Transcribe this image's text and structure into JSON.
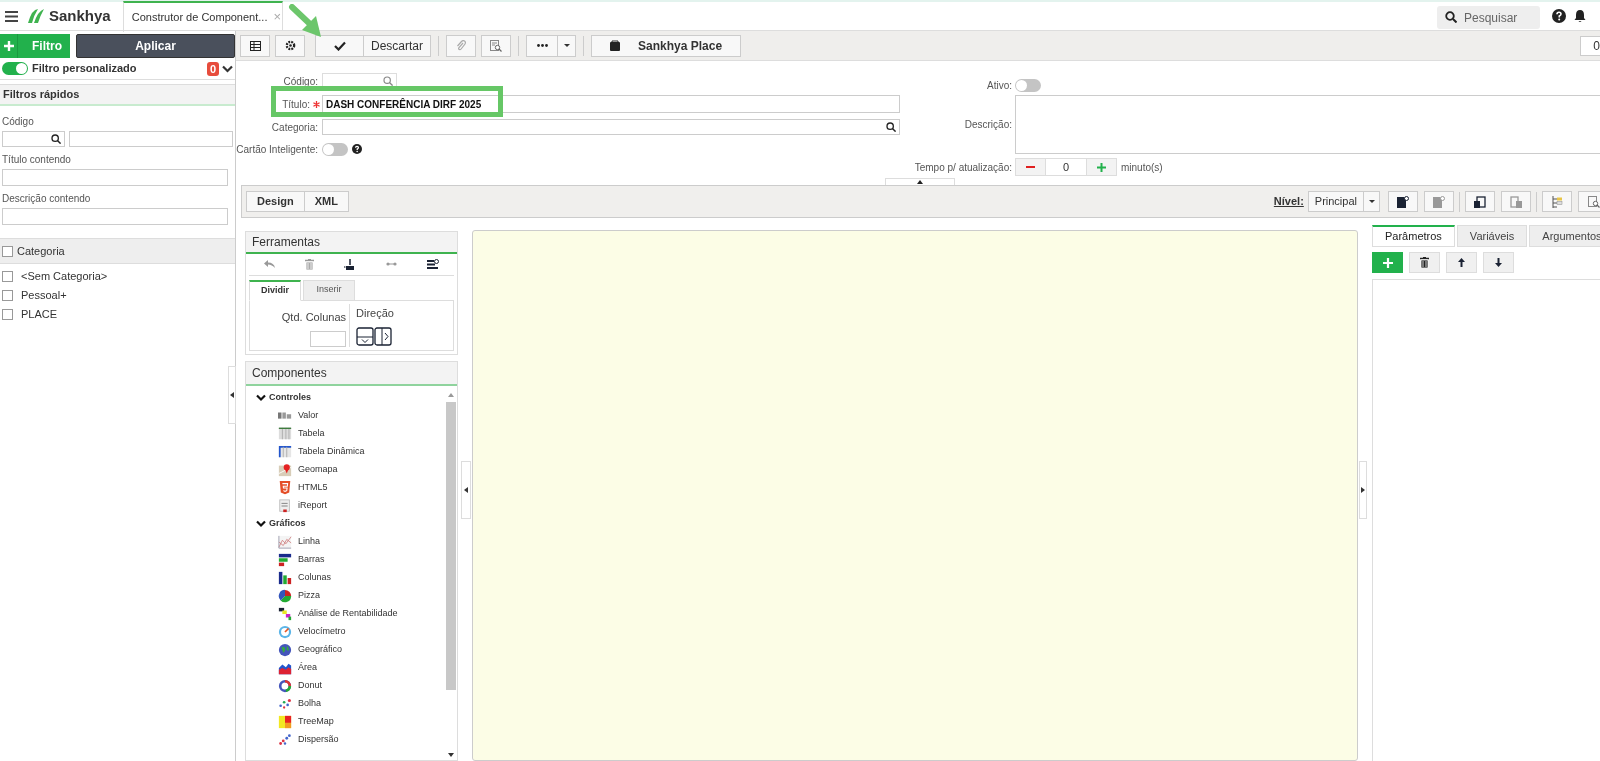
{
  "header": {
    "logo": "Sankhya",
    "tab": {
      "label": "Construtor de Component...",
      "close": "×"
    },
    "search": {
      "placeholder": "Pesquisar"
    }
  },
  "toolbar": {
    "discard": "Descartar",
    "place": "Sankhya Place",
    "page": "0"
  },
  "sidebar": {
    "filter_button": "Filtro",
    "apply_button": "Aplicar",
    "custom_filter": {
      "label": "Filtro personalizado",
      "on": true,
      "count": "0"
    },
    "quick_filters": {
      "title": "Filtros rápidos",
      "fields": [
        {
          "label": "Código",
          "kind": "lookup"
        },
        {
          "label": "Título contendo",
          "kind": "text"
        },
        {
          "label": "Descrição contendo",
          "kind": "text"
        }
      ]
    },
    "categories": {
      "header": "Categoria",
      "checked": false,
      "items": [
        {
          "label": "<Sem Categoria>",
          "checked": false
        },
        {
          "label": "Pessoal+",
          "checked": false
        },
        {
          "label": "PLACE",
          "checked": false
        }
      ]
    }
  },
  "form": {
    "code_label": "Código:",
    "title": {
      "label": "Título:",
      "required": true,
      "value": "DASH CONFERÊNCIA DIRF 2025"
    },
    "category_label": "Categoria:",
    "smart_card": {
      "label": "Cartão Inteligente:",
      "on": false
    },
    "active": {
      "label": "Ativo:",
      "on": false
    },
    "description_label": "Descrição:",
    "refresh": {
      "label": "Tempo p/ atualização:",
      "value": "0",
      "unit": "minuto(s)"
    }
  },
  "design_bar": {
    "views": [
      "Design",
      "XML"
    ],
    "level_label": "Nível:",
    "level_value": "Principal"
  },
  "tools": {
    "title": "Ferramentas",
    "tabs": [
      {
        "label": "Dividir",
        "selected": true
      },
      {
        "label": "Inserir",
        "selected": false
      }
    ],
    "columns_label": "Qtd. Colunas",
    "direction_label": "Direção"
  },
  "components": {
    "title": "Componentes",
    "groups": [
      {
        "label": "Controles",
        "expanded": true,
        "children": [
          {
            "label": "Valor",
            "kind": "value"
          },
          {
            "label": "Tabela",
            "kind": "table"
          },
          {
            "label": "Tabela Dinâmica",
            "kind": "pivot"
          },
          {
            "label": "Geomapa",
            "kind": "map"
          },
          {
            "label": "HTML5",
            "kind": "html"
          },
          {
            "label": "iReport",
            "kind": "report"
          }
        ]
      },
      {
        "label": "Gráficos",
        "expanded": true,
        "children": [
          {
            "label": "Linha",
            "kind": "line"
          },
          {
            "label": "Barras",
            "kind": "bars"
          },
          {
            "label": "Colunas",
            "kind": "columns"
          },
          {
            "label": "Pizza",
            "kind": "pie"
          },
          {
            "label": "Análise de Rentabilidade",
            "kind": "steps"
          },
          {
            "label": "Velocímetro",
            "kind": "gauge"
          },
          {
            "label": "Geográfico",
            "kind": "globe"
          },
          {
            "label": "Área",
            "kind": "area"
          },
          {
            "label": "Donut",
            "kind": "donut"
          },
          {
            "label": "Bolha",
            "kind": "bubble"
          },
          {
            "label": "TreeMap",
            "kind": "treemap"
          },
          {
            "label": "Dispersão",
            "kind": "scatter"
          }
        ]
      }
    ]
  },
  "params": {
    "tabs": [
      {
        "label": "Parâmetros",
        "selected": true
      },
      {
        "label": "Variáveis",
        "selected": false
      },
      {
        "label": "Argumentos",
        "selected": false
      }
    ]
  }
}
